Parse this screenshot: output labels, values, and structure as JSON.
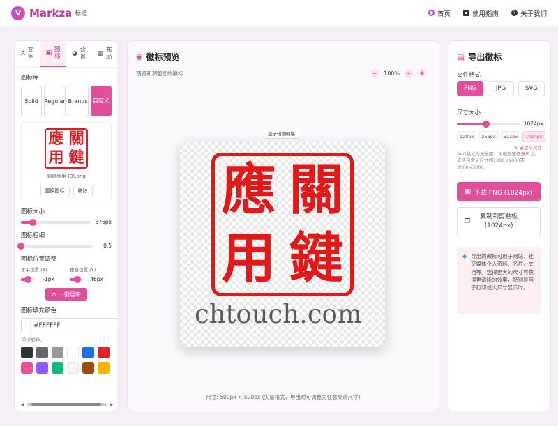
{
  "header": {
    "logo_glyph": "V",
    "brand": "Markza",
    "brand_sub": "标造",
    "nav": [
      {
        "label": "首页",
        "icon": "home-icon"
      },
      {
        "label": "使用指南",
        "icon": "book-icon"
      },
      {
        "label": "关于我们",
        "icon": "question-icon"
      }
    ]
  },
  "left": {
    "tabs": [
      {
        "label": "文字",
        "icon": "text-icon"
      },
      {
        "label": "图标",
        "icon": "image-icon"
      },
      {
        "label": "背景",
        "icon": "palette-icon"
      },
      {
        "label": "布局",
        "icon": "layout-icon"
      }
    ],
    "library_label": "图标库",
    "library_buttons": [
      "Solid",
      "Regular",
      "Brands",
      "自定义"
    ],
    "icon_file": "關鍵應用 (3).png",
    "replace_label": "更换图标",
    "remove_label": "移除",
    "size_label": "图标大小",
    "size_value": "376px",
    "size_fraction": 0.17,
    "stroke_label": "图标粗细",
    "stroke_value": "0.5",
    "stroke_fraction": 0.0,
    "position_label": "图标位置调整",
    "h_pos_label": "水平位置 (X)",
    "h_pos_value": "-1px",
    "h_pos_fraction": 0.5,
    "v_pos_label": "垂直位置 (Y)",
    "v_pos_value": "46px",
    "v_pos_fraction": 0.55,
    "center_button": "一键居中",
    "fill_label": "图标填充颜色",
    "fill_value": "#FFFFFF",
    "preset_label": "预设颜色:",
    "preset_colors": [
      "#333333",
      "#666666",
      "#999999",
      "#FFFFFF",
      "#1E6FE0",
      "#D9262C",
      "#E8519A",
      "#8B5CF6",
      "#10B981",
      "#F5F5F5",
      "#9A4A12",
      "#F5B400"
    ]
  },
  "center": {
    "title": "徽标预览",
    "subtitle": "预览和调整您的徽标",
    "zoom": "100%",
    "grid_button": "显示辅助网格",
    "seal_chars": [
      "應",
      "關",
      "用",
      "鍵"
    ],
    "watermark": "chtouch.com",
    "footer": "尺寸: 500px × 500px (矢量格式，导出时可调整为任意高清尺寸)"
  },
  "right": {
    "title": "导出徽标",
    "format_label": "文件格式",
    "formats": [
      "PNG",
      "JPG",
      "SVG"
    ],
    "active_format": "PNG",
    "size_label": "尺寸大小",
    "size_value": "1024px",
    "size_fraction": 0.47,
    "size_chips": [
      "128px",
      "256px",
      "512px",
      "1024px"
    ],
    "active_chip": "1024px",
    "custom_link": "自定义尺寸",
    "hint": "SVG格式为矢量图，可缩放至任意尺寸。支持自定义尺寸如1000×1000或3000×3000。",
    "download_button": "下载 PNG (1024px)",
    "copy_button_line1": "复制到剪贴板",
    "copy_button_line2": "(1024px)",
    "note": "导出的徽标可用于网站、社交媒体个人资料、名片、文档等。选择更大的尺寸可获得更清晰的效果，特别是用于打印或大尺寸显示时。"
  }
}
